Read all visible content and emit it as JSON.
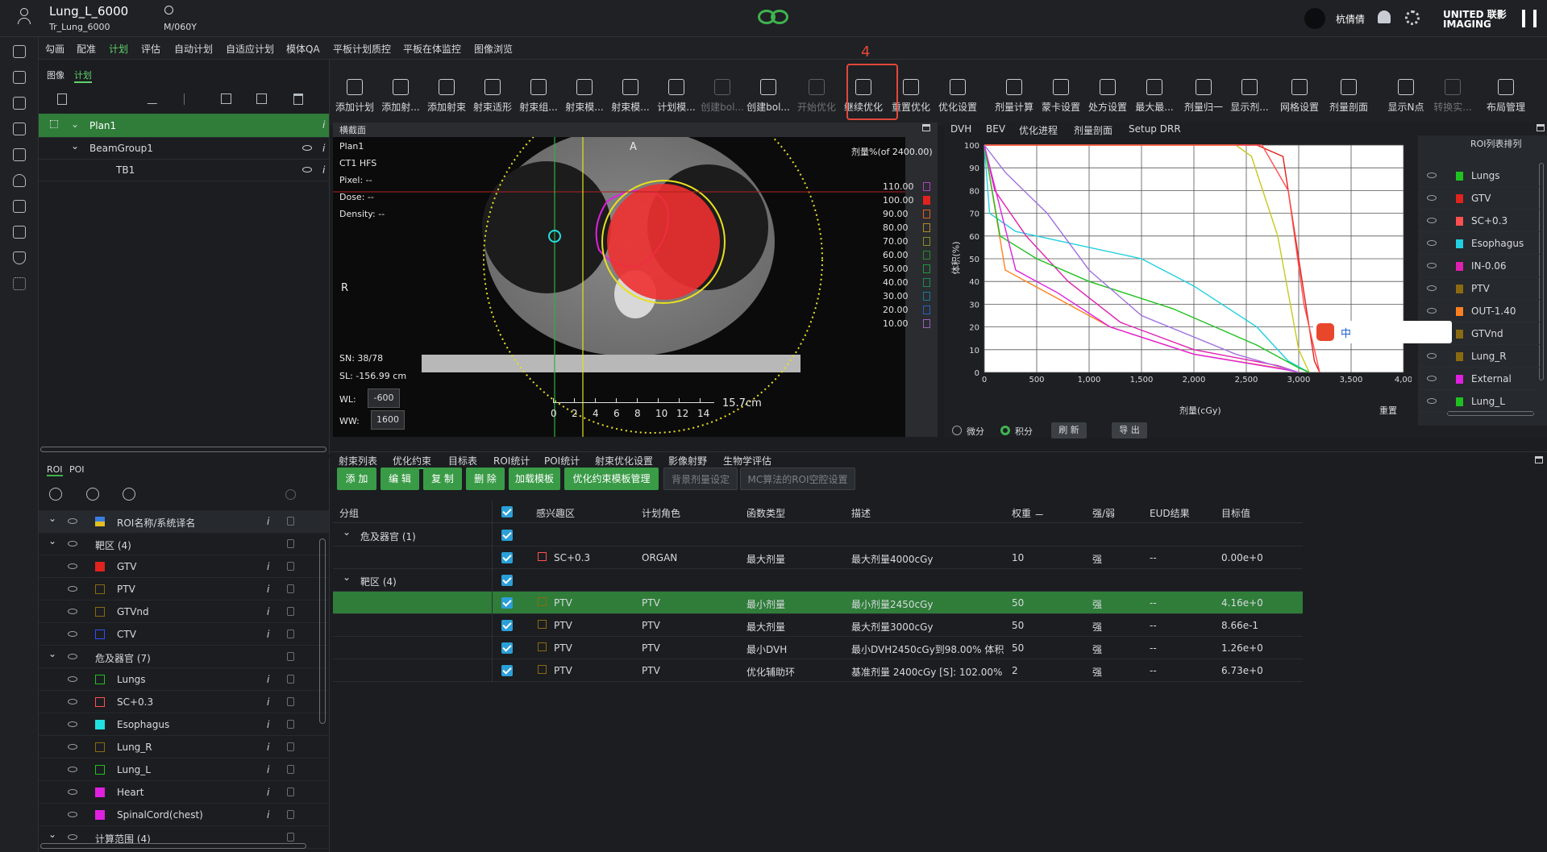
{
  "header": {
    "patient": "Lung_L_6000",
    "plan_id": "Tr_Lung_6000",
    "mrn": "M/060Y",
    "user": "杭倩倩",
    "brand": "UNITED 联影 IMAGING"
  },
  "menu": [
    "勾画",
    "配准",
    "计划",
    "评估",
    "自动计划",
    "自适应计划",
    "模体QA",
    "平板计划质控",
    "平板在体监控",
    "图像浏览"
  ],
  "menu_active": 2,
  "step_marker": "4",
  "toolbar": [
    {
      "label": "添加计划",
      "icon": "add-plan-icon",
      "enabled": true
    },
    {
      "label": "添加射...",
      "icon": "add-beam-icon",
      "enabled": true
    },
    {
      "label": "添加射束",
      "icon": "add-beam2-icon",
      "enabled": true
    },
    {
      "label": "射束适形",
      "icon": "beam-conform-icon",
      "enabled": true
    },
    {
      "label": "射束组...",
      "icon": "beam-group-icon",
      "enabled": true
    },
    {
      "label": "射束模...",
      "icon": "beam-template-icon",
      "enabled": true
    },
    {
      "label": "射束模...",
      "icon": "beam-template2-icon",
      "enabled": true
    },
    {
      "label": "计划模...",
      "icon": "plan-template-icon",
      "enabled": true
    },
    {
      "label": "创建bol...",
      "icon": "create-bolus-icon",
      "enabled": false
    },
    {
      "label": "创建bol...",
      "icon": "create-bolus2-icon",
      "enabled": true
    },
    {
      "label": "开始优化",
      "icon": "start-opt-icon",
      "enabled": false
    },
    {
      "label": "继续优化",
      "icon": "continue-opt-icon",
      "enabled": true
    },
    {
      "label": "重置优化",
      "icon": "reset-opt-icon",
      "enabled": true
    },
    {
      "label": "优化设置",
      "icon": "opt-settings-icon",
      "enabled": true
    },
    {
      "label": "剂量计算",
      "icon": "dose-calc-icon",
      "enabled": true
    },
    {
      "label": "蒙卡设置",
      "icon": "mc-settings-icon",
      "enabled": true
    },
    {
      "label": "处方设置",
      "icon": "rx-settings-icon",
      "enabled": true
    },
    {
      "label": "最大最...",
      "icon": "maxmin-icon",
      "enabled": true
    },
    {
      "label": "剂量归一",
      "icon": "dose-normalize-icon",
      "enabled": true
    },
    {
      "label": "显示剂...",
      "icon": "show-dose-icon",
      "enabled": true
    },
    {
      "label": "网格设置",
      "icon": "grid-settings-icon",
      "enabled": true
    },
    {
      "label": "剂量剖面",
      "icon": "dose-profile-icon",
      "enabled": true
    },
    {
      "label": "显示N点",
      "icon": "show-n-icon",
      "enabled": true
    },
    {
      "label": "转换实...",
      "icon": "convert-icon",
      "enabled": false
    },
    {
      "label": "布局管理",
      "icon": "layout-icon",
      "enabled": true
    }
  ],
  "plan_panel": {
    "tabs": [
      "图像",
      "计划"
    ],
    "rows": [
      "Plan1",
      "BeamGroup1",
      "TB1"
    ]
  },
  "viewer": {
    "title": "横截面",
    "plan": "Plan1",
    "image": "CT1 HFS",
    "pixel": "Pixel:  --",
    "dose": "Dose:  --",
    "density": "Density:  --",
    "sn": "SN: 38/78",
    "sl": "SL: -156.99 cm",
    "wl_label": "WL:",
    "wl": "-600",
    "ww_label": "WW:",
    "ww": "1600",
    "dose_title": "剂量%(of 2400.00)",
    "orient_a": "A",
    "orient_r": "R",
    "scale": "15.7cm",
    "ruler_ticks": [
      "0",
      "2",
      "4",
      "6",
      "8",
      "10",
      "12",
      "14"
    ],
    "isodose": [
      {
        "v": "110.00",
        "c": "#b040c0"
      },
      {
        "v": "100.00",
        "c": "#e0231c"
      },
      {
        "v": "90.00",
        "c": "#e06020"
      },
      {
        "v": "80.00",
        "c": "#b08a20"
      },
      {
        "v": "70.00",
        "c": "#8a8a20"
      },
      {
        "v": "60.00",
        "c": "#2a8a2a"
      },
      {
        "v": "50.00",
        "c": "#1f9a3a"
      },
      {
        "v": "40.00",
        "c": "#1a8a5a"
      },
      {
        "v": "30.00",
        "c": "#1a7a9a"
      },
      {
        "v": "20.00",
        "c": "#2a60c0"
      },
      {
        "v": "10.00",
        "c": "#9a60c0"
      }
    ]
  },
  "dvh": {
    "tabs": [
      "DVH",
      "BEV",
      "优化进程",
      "剂量剖面",
      "Setup DRR"
    ],
    "ylabel": "体积(%)",
    "xlabel": "剂量(cGy)",
    "reset": "重置",
    "differential": "微分",
    "cumulative": "积分",
    "refresh": "刷 新",
    "export": "导 出",
    "sort_label": "ROI列表排列"
  },
  "chart_data": {
    "type": "line",
    "xlabel": "剂量(cGy)",
    "ylabel": "体积(%)",
    "xlim": [
      0,
      4000
    ],
    "ylim": [
      0,
      100
    ],
    "x_ticks": [
      "0",
      "500",
      "1,000",
      "1,500",
      "2,000",
      "2,500",
      "3,000",
      "3,500",
      "4,00"
    ],
    "y_ticks": [
      "0",
      "10",
      "20",
      "30",
      "40",
      "50",
      "60",
      "70",
      "80",
      "90",
      "100"
    ],
    "series": [
      {
        "name": "GTV",
        "color": "#e0231c",
        "points": [
          [
            0,
            100
          ],
          [
            2600,
            100
          ],
          [
            2850,
            95
          ],
          [
            3000,
            50
          ],
          [
            3150,
            5
          ],
          [
            3200,
            0
          ]
        ]
      },
      {
        "name": "PTV",
        "color": "#c8c81e",
        "points": [
          [
            0,
            100
          ],
          [
            2400,
            100
          ],
          [
            2550,
            95
          ],
          [
            2800,
            60
          ],
          [
            3000,
            10
          ],
          [
            3100,
            0
          ]
        ]
      },
      {
        "name": "SC+0.3",
        "color": "#ff5050",
        "points": [
          [
            0,
            100
          ],
          [
            2650,
            100
          ],
          [
            2900,
            80
          ],
          [
            3050,
            30
          ],
          [
            3200,
            0
          ]
        ]
      },
      {
        "name": "Esophagus",
        "color": "#20d0e0",
        "points": [
          [
            0,
            100
          ],
          [
            50,
            70
          ],
          [
            300,
            62
          ],
          [
            1000,
            55
          ],
          [
            1500,
            50
          ],
          [
            2000,
            38
          ],
          [
            2600,
            20
          ],
          [
            2900,
            5
          ],
          [
            3100,
            0
          ]
        ]
      },
      {
        "name": "IN-0.06",
        "color": "#e020b0",
        "points": [
          [
            0,
            100
          ],
          [
            100,
            80
          ],
          [
            400,
            60
          ],
          [
            800,
            40
          ],
          [
            1300,
            22
          ],
          [
            2000,
            10
          ],
          [
            2800,
            3
          ],
          [
            3000,
            0
          ]
        ]
      },
      {
        "name": "OUT-1.40",
        "color": "#ff8020",
        "points": [
          [
            0,
            100
          ],
          [
            200,
            45
          ],
          [
            600,
            35
          ],
          [
            1200,
            20
          ],
          [
            2000,
            8
          ],
          [
            2800,
            2
          ],
          [
            3000,
            0
          ]
        ]
      },
      {
        "name": "Lungs",
        "color": "#20c020",
        "points": [
          [
            0,
            100
          ],
          [
            150,
            60
          ],
          [
            500,
            50
          ],
          [
            1000,
            40
          ],
          [
            1800,
            28
          ],
          [
            2600,
            12
          ],
          [
            3000,
            2
          ],
          [
            3100,
            0
          ]
        ]
      },
      {
        "name": "External",
        "color": "#e020e0",
        "points": [
          [
            0,
            100
          ],
          [
            300,
            45
          ],
          [
            700,
            35
          ],
          [
            1200,
            20
          ],
          [
            2000,
            8
          ],
          [
            2900,
            1
          ],
          [
            3000,
            0
          ]
        ]
      },
      {
        "name": "Lung_L",
        "color": "#a070e0",
        "points": [
          [
            0,
            100
          ],
          [
            200,
            88
          ],
          [
            600,
            70
          ],
          [
            1000,
            45
          ],
          [
            1500,
            25
          ],
          [
            2400,
            8
          ],
          [
            3000,
            0
          ]
        ]
      }
    ]
  },
  "legend": [
    {
      "name": "Lungs",
      "color": "#20c020"
    },
    {
      "name": "GTV",
      "color": "#e0231c"
    },
    {
      "name": "SC+0.3",
      "color": "#ff5050"
    },
    {
      "name": "Esophagus",
      "color": "#20d0e0"
    },
    {
      "name": "IN-0.06",
      "color": "#e020b0"
    },
    {
      "name": "PTV",
      "color": "#8a6a10"
    },
    {
      "name": "OUT-1.40",
      "color": "#ff8020"
    },
    {
      "name": "GTVnd",
      "color": "#8a6a10"
    },
    {
      "name": "Lung_R",
      "color": "#8a6a10"
    },
    {
      "name": "External",
      "color": "#e020e0"
    },
    {
      "name": "Lung_L",
      "color": "#20c020"
    }
  ],
  "roi_panel": {
    "tabs": [
      "ROI",
      "POI"
    ],
    "header": "ROI名称/系统译名",
    "rows": [
      {
        "type": "group",
        "name": "靶区 (4)"
      },
      {
        "type": "roi",
        "name": "GTV",
        "color": "#e0231c",
        "fill": true
      },
      {
        "type": "roi",
        "name": "PTV",
        "color": "#8a6a10",
        "fill": false
      },
      {
        "type": "roi",
        "name": "GTVnd",
        "color": "#8a6a10",
        "fill": false
      },
      {
        "type": "roi",
        "name": "CTV",
        "color": "#3050ff",
        "fill": false
      },
      {
        "type": "group",
        "name": "危及器官 (7)"
      },
      {
        "type": "roi",
        "name": "Lungs",
        "color": "#20c020",
        "fill": false
      },
      {
        "type": "roi",
        "name": "SC+0.3",
        "color": "#ff5050",
        "fill": false
      },
      {
        "type": "roi",
        "name": "Esophagus",
        "color": "#20e0e0",
        "fill": true
      },
      {
        "type": "roi",
        "name": "Lung_R",
        "color": "#8a6a10",
        "fill": false
      },
      {
        "type": "roi",
        "name": "Lung_L",
        "color": "#20c020",
        "fill": false
      },
      {
        "type": "roi",
        "name": "Heart",
        "color": "#e020e0",
        "fill": true
      },
      {
        "type": "roi",
        "name": "SpinalCord(chest)",
        "color": "#e020e0",
        "fill": true
      },
      {
        "type": "group",
        "name": "计算范围 (4)"
      }
    ]
  },
  "bottom": {
    "tabs": [
      "射束列表",
      "优化约束",
      "目标表",
      "ROI统计",
      "POI统计",
      "射束优化设置",
      "影像射野",
      "生物学评估"
    ],
    "active_tab": 1,
    "buttons": [
      {
        "label": "添 加",
        "enabled": true
      },
      {
        "label": "编 辑",
        "enabled": true
      },
      {
        "label": "复 制",
        "enabled": true
      },
      {
        "label": "删 除",
        "enabled": true
      },
      {
        "label": "加载模板",
        "enabled": true
      },
      {
        "label": "优化约束模板管理",
        "enabled": true
      },
      {
        "label": "背景剂量设定",
        "enabled": false
      },
      {
        "label": "MC算法的ROI空腔设置",
        "enabled": false
      }
    ],
    "columns": [
      "分组",
      "",
      "感兴趣区",
      "计划角色",
      "函数类型",
      "描述",
      "权重",
      "强/弱",
      "EUD结果",
      "目标值"
    ],
    "groups": [
      {
        "name": "危及器官 (1)",
        "rows": [
          {
            "roi": "SC+0.3",
            "color": "#ff5050",
            "role": "ORGAN",
            "func": "最大剂量",
            "desc": "最大剂量4000cGy",
            "weight": "10",
            "strength": "强",
            "eud": "--",
            "target": "0.00e+0"
          }
        ]
      },
      {
        "name": "靶区 (4)",
        "rows": [
          {
            "roi": "PTV",
            "color": "#8a6a10",
            "role": "PTV",
            "func": "最小剂量",
            "desc": "最小剂量2450cGy",
            "weight": "50",
            "strength": "强",
            "eud": "--",
            "target": "4.16e+0",
            "selected": true
          },
          {
            "roi": "PTV",
            "color": "#8a6a10",
            "role": "PTV",
            "func": "最大剂量",
            "desc": "最大剂量3000cGy",
            "weight": "50",
            "strength": "强",
            "eud": "--",
            "target": "8.66e-1"
          },
          {
            "roi": "PTV",
            "color": "#8a6a10",
            "role": "PTV",
            "func": "最小DVH",
            "desc": "最小DVH2450cGy到98.00% 体积",
            "weight": "50",
            "strength": "强",
            "eud": "--",
            "target": "1.26e+0"
          },
          {
            "roi": "PTV",
            "color": "#8a6a10",
            "role": "PTV",
            "func": "优化辅助环",
            "desc": "基准剂量 2400cGy [S]: 102.00% [...",
            "weight": "2",
            "strength": "强",
            "eud": "--",
            "target": "6.73e+0"
          }
        ]
      }
    ]
  }
}
